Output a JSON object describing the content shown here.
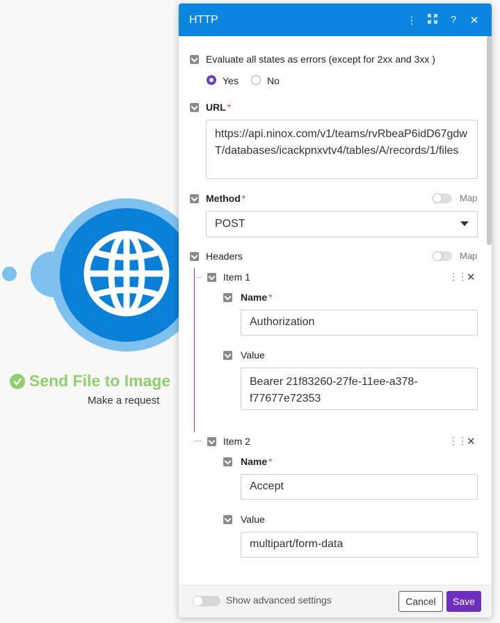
{
  "module": {
    "title": "Send File to Image",
    "subtitle": "Make a request"
  },
  "panel": {
    "title": "HTTP",
    "header_buttons": [
      "more-icon",
      "expand-icon",
      "help-icon",
      "close-icon"
    ]
  },
  "fields": {
    "evaluate_errors": {
      "label": "Evaluate all states as errors (except for 2xx and 3xx )",
      "options": [
        "Yes",
        "No"
      ],
      "selected": "Yes"
    },
    "url": {
      "label": "URL",
      "required": "*",
      "value": "https://api.ninox.com/v1/teams/rvRbeaP6idD67gdwT/databases/icackpnxvtv4/tables/A/records/1/files"
    },
    "method": {
      "label": "Method",
      "required": "*",
      "map_label": "Map",
      "value": "POST"
    },
    "headers": {
      "label": "Headers",
      "map_label": "Map",
      "items": [
        {
          "title": "Item 1",
          "name_label": "Name",
          "name_value": "Authorization",
          "value_label": "Value",
          "value_value": "Bearer 21f83260-27fe-11ee-a378-f77677e72353"
        },
        {
          "title": "Item 2",
          "name_label": "Name",
          "name_value": "Accept",
          "value_label": "Value",
          "value_value": "multipart/form-data"
        }
      ]
    }
  },
  "footer": {
    "advanced_label": "Show advanced settings",
    "cancel_label": "Cancel",
    "save_label": "Save"
  },
  "colors": {
    "header": "#0a86e0",
    "save": "#6d2fbf",
    "success": "#8fcf6f",
    "module": "#0a7fd8"
  }
}
